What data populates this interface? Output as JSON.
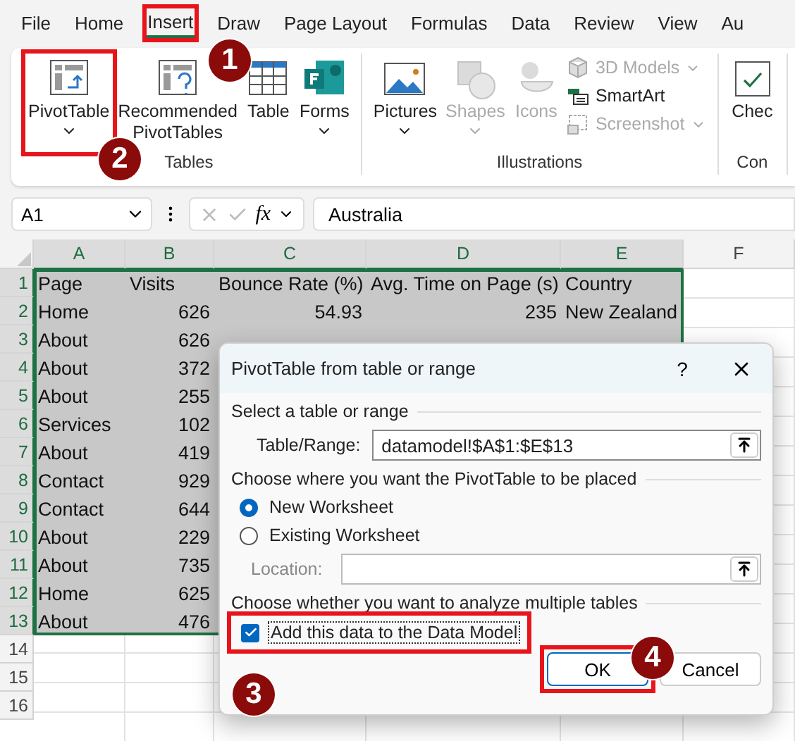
{
  "menu_tabs": [
    {
      "label": "File",
      "selected": false,
      "highlighted": false
    },
    {
      "label": "Home",
      "selected": false,
      "highlighted": false
    },
    {
      "label": "Insert",
      "selected": true,
      "highlighted": true
    },
    {
      "label": "Draw",
      "selected": false,
      "highlighted": false
    },
    {
      "label": "Page Layout",
      "selected": false,
      "highlighted": false
    },
    {
      "label": "Formulas",
      "selected": false,
      "highlighted": false
    },
    {
      "label": "Data",
      "selected": false,
      "highlighted": false
    },
    {
      "label": "Review",
      "selected": false,
      "highlighted": false
    },
    {
      "label": "View",
      "selected": false,
      "highlighted": false
    },
    {
      "label": "Au",
      "selected": false,
      "highlighted": false
    }
  ],
  "ribbon_groups": [
    {
      "label": "Tables",
      "buttons": [
        {
          "kind": "pivot",
          "label": "PivotTable",
          "dropdown": true,
          "disabled": false,
          "highlighted": true
        },
        {
          "kind": "recommended",
          "label": "Recommended PivotTables",
          "dropdown": false,
          "disabled": false,
          "highlighted": false
        },
        {
          "kind": "table",
          "label": "Table",
          "dropdown": false,
          "disabled": false,
          "highlighted": false
        },
        {
          "kind": "forms",
          "label": "Forms",
          "dropdown": true,
          "disabled": false,
          "highlighted": false
        }
      ]
    },
    {
      "label": "Illustrations",
      "buttons": [
        {
          "kind": "pictures",
          "label": "Pictures",
          "dropdown": true,
          "disabled": false,
          "highlighted": false
        },
        {
          "kind": "shapes",
          "label": "Shapes",
          "dropdown": true,
          "disabled": true,
          "highlighted": false
        },
        {
          "kind": "icons",
          "label": "Icons",
          "dropdown": false,
          "disabled": true,
          "highlighted": false
        }
      ],
      "small_buttons": [
        {
          "kind": "models",
          "label": "3D Models",
          "dropdown": true,
          "disabled": true
        },
        {
          "kind": "smartart",
          "label": "SmartArt",
          "dropdown": false,
          "disabled": false
        },
        {
          "kind": "screenshot",
          "label": "Screenshot",
          "dropdown": true,
          "disabled": true
        }
      ]
    },
    {
      "label": "Con",
      "buttons": [
        {
          "kind": "check",
          "label": "Chec",
          "dropdown": false,
          "disabled": false,
          "highlighted": false
        }
      ]
    }
  ],
  "formula_bar": {
    "name_box": "A1",
    "function_label": "fx",
    "formula": "Australia"
  },
  "columns": [
    {
      "label": "A",
      "selected": true
    },
    {
      "label": "B",
      "selected": true
    },
    {
      "label": "C",
      "selected": true
    },
    {
      "label": "D",
      "selected": true
    },
    {
      "label": "E",
      "selected": true
    },
    {
      "label": "F",
      "selected": false
    }
  ],
  "rows": [
    {
      "number": "1",
      "selected": true,
      "cells": [
        "Page",
        "Visits",
        "Bounce Rate (%)",
        "Avg. Time on Page (s)",
        "Country"
      ]
    },
    {
      "number": "2",
      "selected": true,
      "cells": [
        "Home",
        "626",
        "54.93",
        "235",
        "New Zealand"
      ]
    },
    {
      "number": "3",
      "selected": true,
      "cells": [
        "About",
        "626"
      ]
    },
    {
      "number": "4",
      "selected": true,
      "cells": [
        "About",
        "372"
      ]
    },
    {
      "number": "5",
      "selected": true,
      "cells": [
        "About",
        "255"
      ]
    },
    {
      "number": "6",
      "selected": true,
      "cells": [
        "Services",
        "102"
      ]
    },
    {
      "number": "7",
      "selected": true,
      "cells": [
        "About",
        "419"
      ]
    },
    {
      "number": "8",
      "selected": true,
      "cells": [
        "Contact",
        "929"
      ]
    },
    {
      "number": "9",
      "selected": true,
      "cells": [
        "Contact",
        "644"
      ]
    },
    {
      "number": "10",
      "selected": true,
      "cells": [
        "About",
        "229"
      ]
    },
    {
      "number": "11",
      "selected": true,
      "cells": [
        "About",
        "735"
      ]
    },
    {
      "number": "12",
      "selected": true,
      "cells": [
        "Home",
        "625"
      ]
    },
    {
      "number": "13",
      "selected": true,
      "cells": [
        "About",
        "476"
      ]
    },
    {
      "number": "14",
      "selected": false
    },
    {
      "number": "15",
      "selected": false
    },
    {
      "number": "16",
      "selected": false
    }
  ],
  "dialog": {
    "title": "PivotTable from table or range",
    "help": "?",
    "section_source": "Select a table or range",
    "range_label": "Table/Range:",
    "range_value": "datamodel!$A$1:$E$13",
    "section_place": "Choose where you want the PivotTable to be placed",
    "placements": [
      {
        "label": "New Worksheet",
        "selected": true
      },
      {
        "label": "Existing Worksheet",
        "selected": false
      }
    ],
    "location": {
      "label": "Location:",
      "disabled": true
    },
    "section_tables": "Choose whether you want to analyze multiple tables",
    "data_model": {
      "label": "Add this data to the Data Model",
      "checked": true,
      "highlighted": true
    },
    "buttons": [
      {
        "label": "OK",
        "default": true,
        "highlighted": true
      },
      {
        "label": "Cancel",
        "default": false,
        "highlighted": false
      }
    ]
  },
  "callouts": [
    {
      "number": "1"
    },
    {
      "number": "2"
    },
    {
      "number": "3"
    },
    {
      "number": "4"
    }
  ]
}
